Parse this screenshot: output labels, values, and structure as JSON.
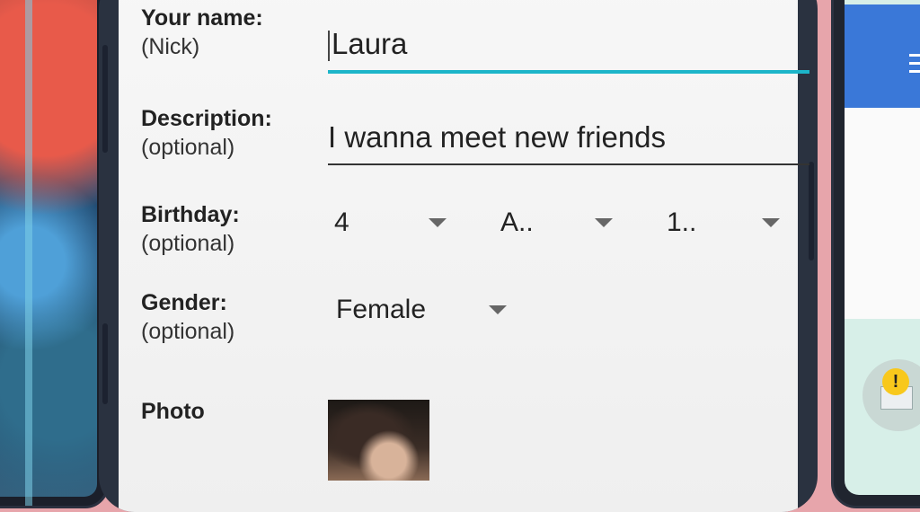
{
  "form": {
    "name_label": "Your name:",
    "name_hint": "(Nick)",
    "name_value": "Laura",
    "description_label": "Description:",
    "description_hint": "(optional)",
    "description_value": "I wanna meet new friends",
    "birthday_label": "Birthday:",
    "birthday_hint": "(optional)",
    "birthday_day": "4",
    "birthday_month": "A..",
    "birthday_year": "1..",
    "gender_label": "Gender:",
    "gender_hint": "(optional)",
    "gender_value": "Female",
    "photo_label": "Photo"
  },
  "colors": {
    "background": "#e7a5ab",
    "focus_underline": "#1cb5c9",
    "right_app_bar": "#3a78d8",
    "warning": "#f8c81c"
  },
  "icons": {
    "dropdown": "triangle-down-icon",
    "warning": "exclamation-icon",
    "mail": "envelope-icon"
  }
}
